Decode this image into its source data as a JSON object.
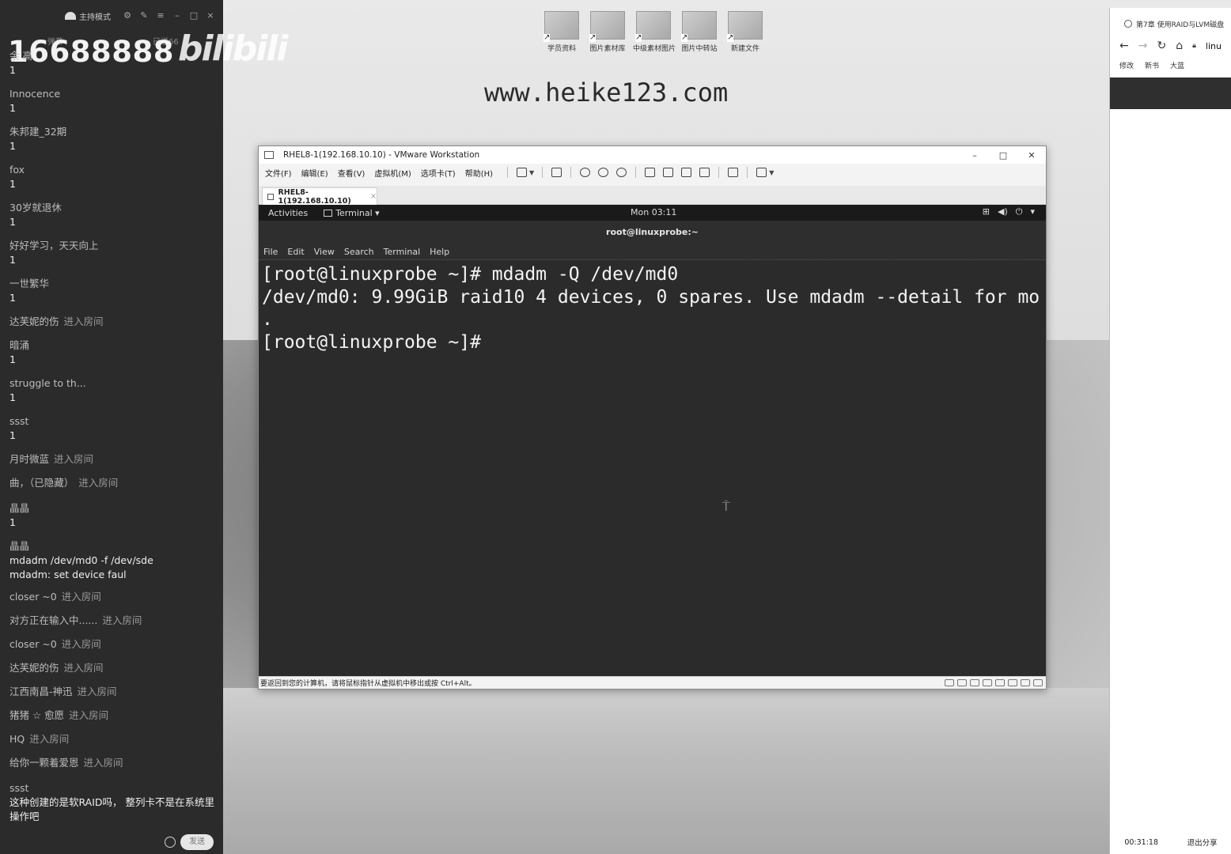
{
  "chat": {
    "title_mode": "主持模式",
    "watermark_number": "16688888",
    "watermark_logo": "bilibili",
    "watermark_small_left": "弹幕",
    "watermark_small_right": "已送66",
    "messages": [
      {
        "name": "余 高",
        "text": "1"
      },
      {
        "name": "Innocence",
        "text": "1"
      },
      {
        "name": "朱邦建_32期",
        "text": "1"
      },
      {
        "name": "fox",
        "text": "1"
      },
      {
        "name": "30岁就退休",
        "text": "1"
      },
      {
        "name": "好好学习，天天向上",
        "text": "1"
      },
      {
        "name": "一世繁华",
        "text": "1"
      },
      {
        "name": "达芙妮的伤",
        "join": "进入房间"
      },
      {
        "name": "暗涌",
        "text": "1"
      },
      {
        "name": "struggle to th...",
        "text": "1"
      },
      {
        "name": "ssst",
        "text": "1"
      },
      {
        "name": "月时微蓝",
        "join": "进入房间"
      },
      {
        "name": "曲，（已隐藏）",
        "join": "进入房间"
      },
      {
        "name": "晶晶",
        "text": "1"
      },
      {
        "name": "晶晶",
        "text": "mdadm /dev/md0 -f /dev/sde\nmdadm: set device faul"
      },
      {
        "name": "closer ~0",
        "join": "进入房间"
      },
      {
        "name": "对方正在输入中......",
        "join": "进入房间"
      },
      {
        "name": "closer ~0",
        "join": "进入房间"
      },
      {
        "name": "达芙妮的伤",
        "join": "进入房间"
      },
      {
        "name": "江西南昌-神迅",
        "join": "进入房间"
      },
      {
        "name": "猪猪 ☆ 愈愿",
        "join": "进入房间"
      },
      {
        "name": "HQ",
        "join": "进入房间"
      },
      {
        "name": "给你一颗着爱恩",
        "join": "进入房间"
      },
      {
        "name": "ssst",
        "text": "这种创建的是软RAID吗， 整列卡不是在系统里操作吧"
      }
    ],
    "send_label": "发送"
  },
  "desktop": {
    "icons": [
      "学员资料",
      "图片素材库",
      "中级素材图片",
      "图片中转站",
      "新建文件"
    ],
    "site_watermark": "www.heike123.com"
  },
  "vmware": {
    "title": "RHEL8-1(192.168.10.10) - VMware Workstation",
    "menus": [
      "文件(F)",
      "编辑(E)",
      "查看(V)",
      "虚拟机(M)",
      "选项卡(T)",
      "帮助(H)"
    ],
    "tab_label": "RHEL8-1(192.168.10.10)",
    "status_text": "要返回到您的计算机，请将鼠标指针从虚拟机中移出或按 Ctrl+Alt。"
  },
  "guest": {
    "activities": "Activities",
    "terminal_app": "Terminal ▾",
    "clock": "Mon 03:11",
    "window_title": "root@linuxprobe:~",
    "menus": [
      "File",
      "Edit",
      "View",
      "Search",
      "Terminal",
      "Help"
    ],
    "lines": [
      "[root@linuxprobe ~]# mdadm -Q /dev/md0",
      "/dev/md0: 9.99GiB raid10 4 devices, 0 spares. Use mdadm --detail for mo",
      ".",
      "[root@linuxprobe ~]#"
    ]
  },
  "browser": {
    "tab_title": "第7章 使用RAID与LVM磁盘",
    "url": "linu",
    "bookmarks": [
      "修改",
      "新书",
      "大蓝"
    ],
    "timer": "00:31:18",
    "exit_share": "退出分享"
  }
}
